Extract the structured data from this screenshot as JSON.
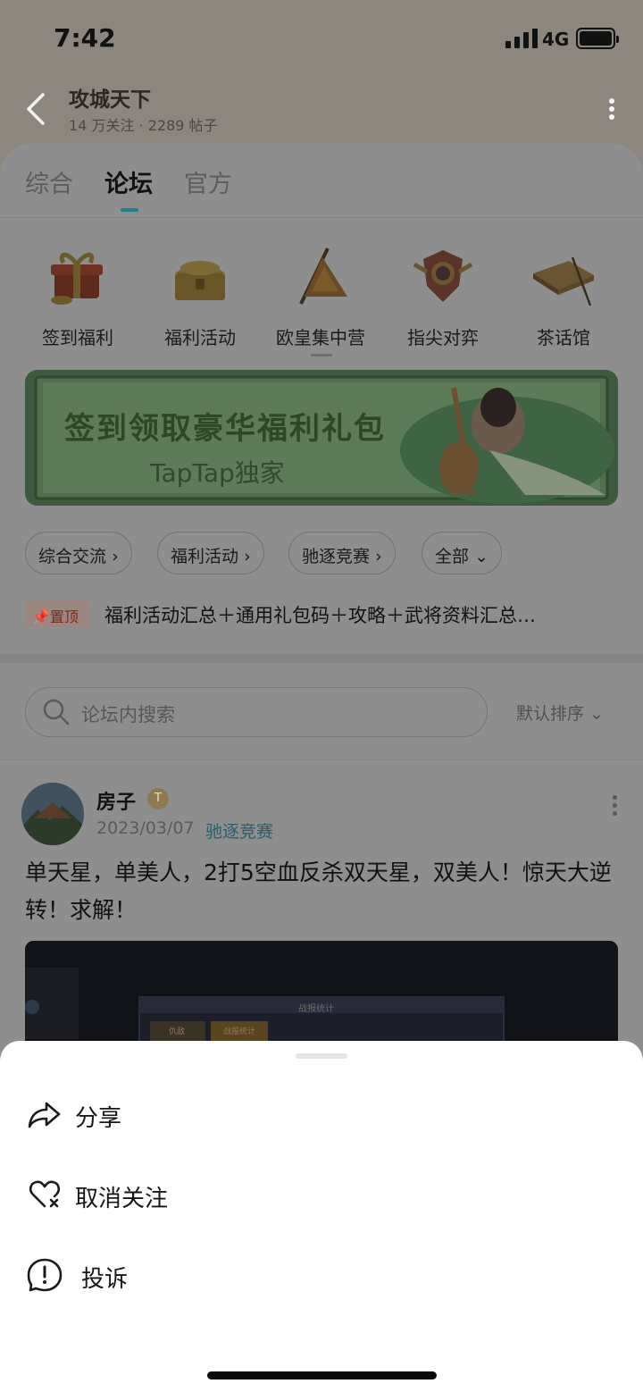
{
  "status_bar": {
    "time": "7:42",
    "network": "4G"
  },
  "header": {
    "title": "攻城天下",
    "subtitle": "14 万关注 · 2289 帖子"
  },
  "tabs": [
    {
      "label": "综合"
    },
    {
      "label": "论坛"
    },
    {
      "label": "官方"
    }
  ],
  "categories": [
    {
      "label": "签到福利",
      "icon": "gift-icon"
    },
    {
      "label": "福利活动",
      "icon": "treasure-chest-icon"
    },
    {
      "label": "欧皇集中营",
      "icon": "war-flag-icon"
    },
    {
      "label": "指尖对弈",
      "icon": "shield-crest-icon"
    },
    {
      "label": "茶话馆",
      "icon": "book-icon"
    }
  ],
  "banner": {
    "title": "签到领取豪华福利礼包",
    "subtitle": "TapTap独家"
  },
  "filter_chips": [
    {
      "label": "综合交流"
    },
    {
      "label": "福利活动"
    },
    {
      "label": "驰逐竞赛"
    },
    {
      "label": "全部"
    }
  ],
  "pinned": {
    "badge": "置顶",
    "text": "福利活动汇总＋通用礼包码＋攻略＋武将资料汇总…"
  },
  "search": {
    "placeholder": "论坛内搜索",
    "sort_label": "默认排序"
  },
  "post": {
    "author": "房子",
    "badge": "T",
    "date": "2023/03/07",
    "tag": "驰逐竞赛",
    "title": "单天星，单美人，2打5空血反杀双天星，双美人！惊天大逆转！求解！",
    "image_text": {
      "panel_title": "战报统计",
      "tab1": "仇敌",
      "tab2": "战报统计"
    }
  },
  "sheet": {
    "items": [
      {
        "label": "分享",
        "icon": "share-icon"
      },
      {
        "label": "取消关注",
        "icon": "unfollow-heart-icon"
      },
      {
        "label": "投诉",
        "icon": "report-icon"
      }
    ]
  },
  "colors": {
    "accent": "#1f7e8f",
    "tag": "#275f6c",
    "pin_text": "#7a2a18"
  }
}
